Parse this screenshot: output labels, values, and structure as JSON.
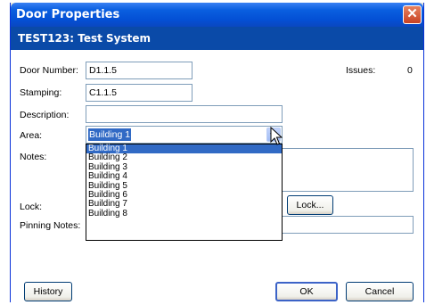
{
  "window": {
    "title": "Door Properties",
    "close_glyph": "✕"
  },
  "header": {
    "text": "TEST123: Test System"
  },
  "form": {
    "door_number_label": "Door Number:",
    "door_number_value": "D1.1.5",
    "stamping_label": "Stamping:",
    "stamping_value": "C1.1.5",
    "description_label": "Description:",
    "description_value": "",
    "area_label": "Area:",
    "area_value": "Building 1",
    "notes_label": "Notes:",
    "lock_label": "Lock:",
    "pinning_label": "Pinning Notes:",
    "issues_label": "Issues:",
    "issues_value": "0"
  },
  "dropdown": {
    "options": [
      "Building 1",
      "Building 2",
      "Building 3",
      "Building 4",
      "Building 5",
      "Building 6",
      "Building 7",
      "Building 8"
    ],
    "selected_index": 0
  },
  "buttons": {
    "lock": "Lock...",
    "history": "History",
    "ok": "OK",
    "cancel": "Cancel"
  },
  "colors": {
    "title_bar": "#0450d5",
    "header_bar": "#0a4aa8",
    "selection": "#316ac5"
  }
}
